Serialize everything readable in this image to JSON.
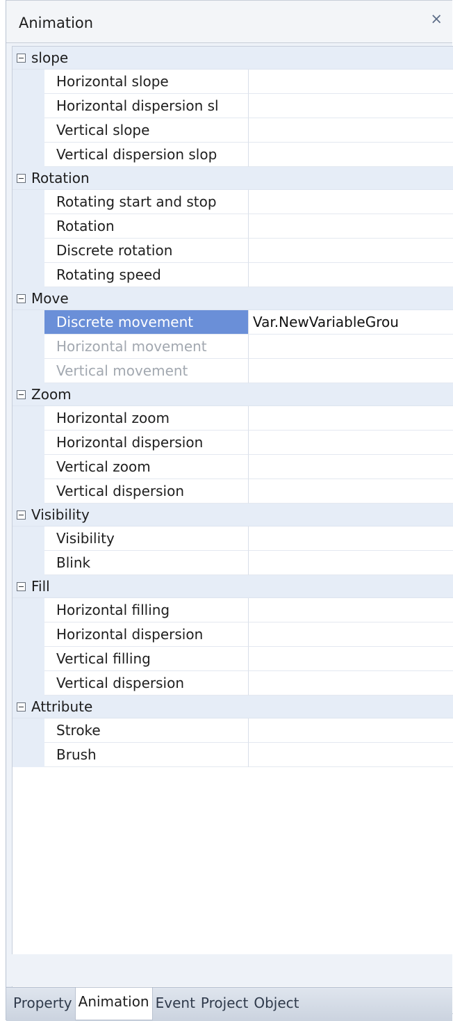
{
  "window": {
    "title": "Animation",
    "close_glyph": "×"
  },
  "groups": [
    {
      "label": "slope",
      "rows": [
        {
          "name": "Horizontal slope",
          "value": ""
        },
        {
          "name": "Horizontal dispersion sl",
          "value": ""
        },
        {
          "name": "Vertical slope",
          "value": ""
        },
        {
          "name": "Vertical dispersion slop",
          "value": ""
        }
      ]
    },
    {
      "label": "Rotation",
      "rows": [
        {
          "name": "Rotating start and stop",
          "value": ""
        },
        {
          "name": "Rotation",
          "value": ""
        },
        {
          "name": "Discrete rotation",
          "value": ""
        },
        {
          "name": "Rotating speed",
          "value": ""
        }
      ]
    },
    {
      "label": "Move",
      "rows": [
        {
          "name": "Discrete movement",
          "value": "Var.NewVariableGrou",
          "state": "selected"
        },
        {
          "name": "Horizontal movement",
          "value": "",
          "state": "disabled"
        },
        {
          "name": "Vertical movement",
          "value": "",
          "state": "disabled"
        }
      ]
    },
    {
      "label": "Zoom",
      "rows": [
        {
          "name": "Horizontal zoom",
          "value": ""
        },
        {
          "name": "Horizontal dispersion",
          "value": ""
        },
        {
          "name": "Vertical zoom",
          "value": ""
        },
        {
          "name": "Vertical dispersion",
          "value": ""
        }
      ]
    },
    {
      "label": "Visibility",
      "rows": [
        {
          "name": "Visibility",
          "value": ""
        },
        {
          "name": "Blink",
          "value": ""
        }
      ]
    },
    {
      "label": "Fill",
      "rows": [
        {
          "name": "Horizontal filling",
          "value": ""
        },
        {
          "name": "Horizontal dispersion",
          "value": ""
        },
        {
          "name": "Vertical filling",
          "value": ""
        },
        {
          "name": "Vertical dispersion",
          "value": ""
        }
      ]
    },
    {
      "label": "Attribute",
      "rows": [
        {
          "name": "Stroke",
          "value": ""
        },
        {
          "name": "Brush",
          "value": ""
        }
      ]
    }
  ],
  "tabs": [
    {
      "label": "Property",
      "active": false
    },
    {
      "label": "Animation",
      "active": true
    },
    {
      "label": "Event",
      "active": false
    },
    {
      "label": "Project",
      "active": false
    },
    {
      "label": "Object",
      "active": false
    }
  ],
  "colors": {
    "selection": "#6a8fd8",
    "group_header": "#e6edf7",
    "disabled_text": "#a2a8b0"
  }
}
